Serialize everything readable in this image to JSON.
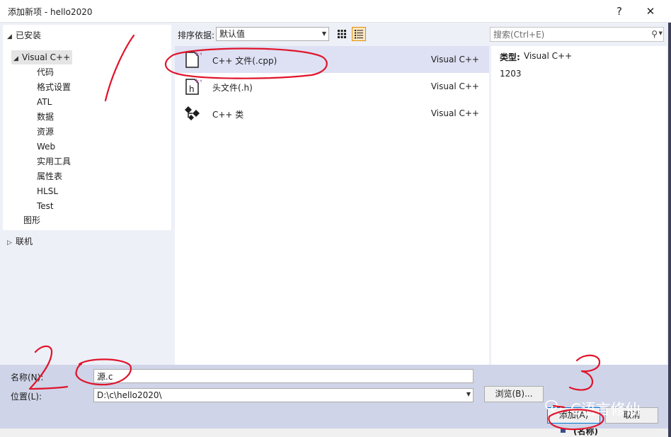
{
  "window": {
    "title": "添加新项 - hello2020",
    "minimize_glyph": "?",
    "close_glyph": "✕"
  },
  "tree": {
    "installed_label": "已安装",
    "visual_cpp_label": "Visual C++",
    "children": [
      "代码",
      "格式设置",
      "ATL",
      "数据",
      "资源",
      "Web",
      "实用工具",
      "属性表",
      "HLSL",
      "Test"
    ],
    "graphics_label": "图形",
    "online_label": "联机"
  },
  "toolbar": {
    "sort_label": "排序依据:",
    "sort_value": "默认值"
  },
  "templates": [
    {
      "name": "C++ 文件(.cpp)",
      "type": "Visual C++",
      "icon": "cpp-file-icon"
    },
    {
      "name": "头文件(.h)",
      "type": "Visual C++",
      "icon": "header-file-icon"
    },
    {
      "name": "C++ 类",
      "type": "Visual C++",
      "icon": "cpp-class-icon"
    }
  ],
  "search": {
    "placeholder": "搜索(Ctrl+E)"
  },
  "details": {
    "type_label": "类型:",
    "type_value": "Visual C++",
    "description": "1203"
  },
  "form": {
    "name_label": "名称(N):",
    "name_value": "源.c",
    "location_label": "位置(L):",
    "location_value": "D:\\c\\hello2020\\",
    "browse_label": "浏览(B)...",
    "add_label": "添加(A)",
    "cancel_label": "取消"
  },
  "annotations": {
    "mark_1": "1",
    "mark_2": "2",
    "mark_3": "3",
    "accent_color": "#e0142b"
  },
  "watermark": {
    "text": "C语言修仙"
  },
  "background": {
    "partial_text": "(名称)"
  }
}
